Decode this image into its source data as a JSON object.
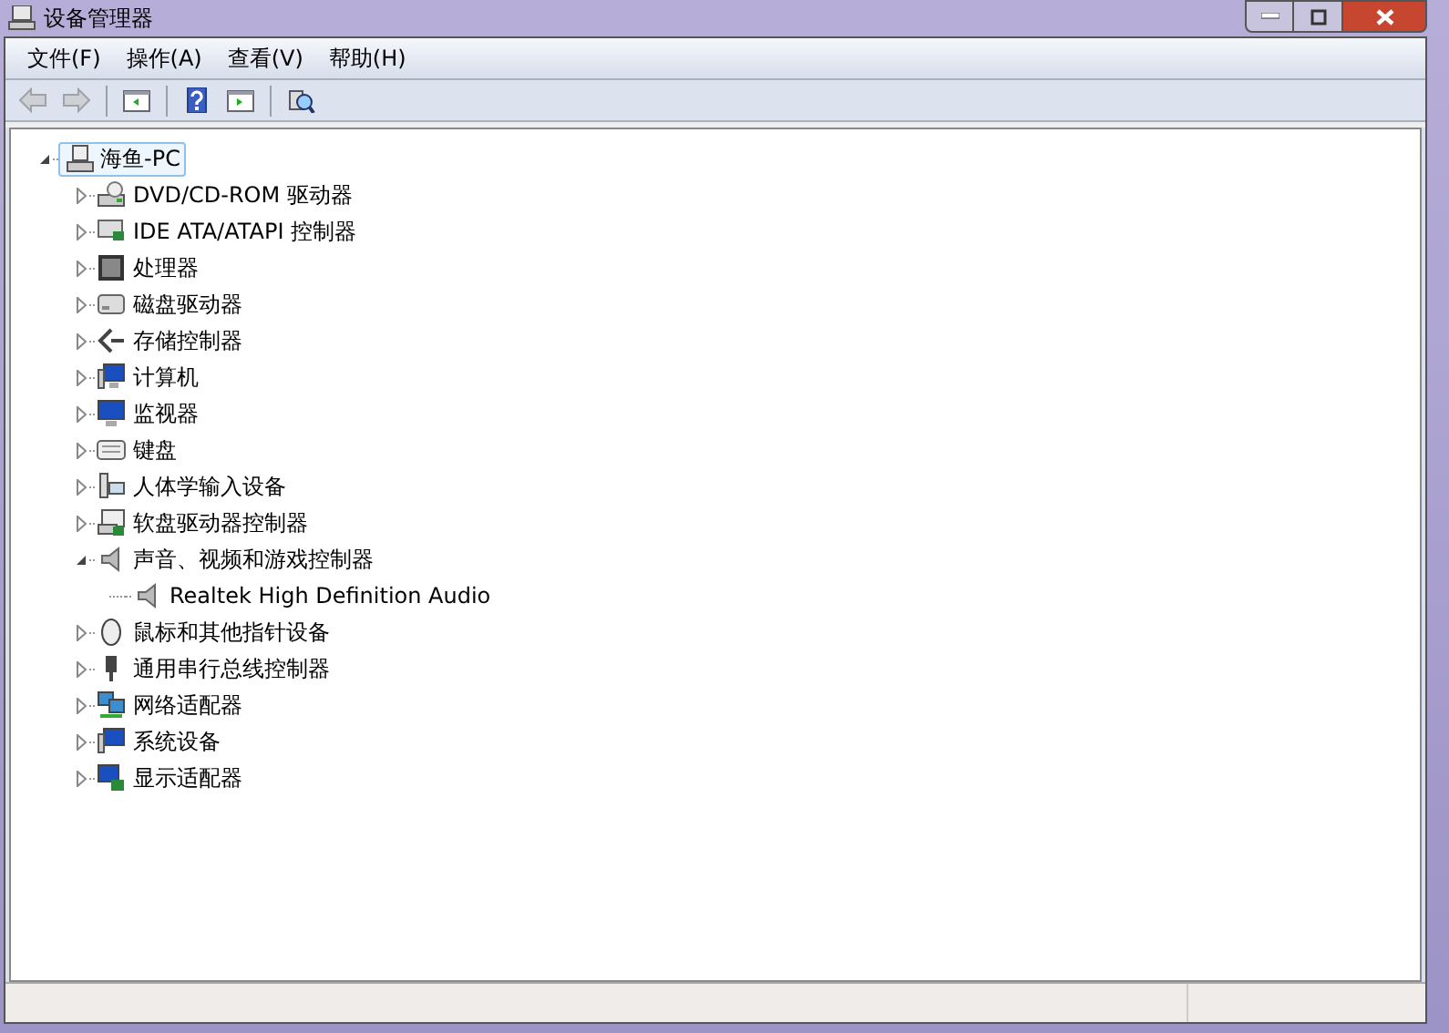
{
  "window": {
    "title": "设备管理器"
  },
  "menu": [
    {
      "label": "文件(F)"
    },
    {
      "label": "操作(A)"
    },
    {
      "label": "查看(V)"
    },
    {
      "label": "帮助(H)"
    }
  ],
  "toolbar": [
    {
      "kind": "back",
      "disabled": true
    },
    {
      "kind": "forward",
      "disabled": true
    },
    {
      "kind": "separator"
    },
    {
      "kind": "console",
      "disabled": false
    },
    {
      "kind": "separator"
    },
    {
      "kind": "help",
      "disabled": false
    },
    {
      "kind": "pane",
      "disabled": false
    },
    {
      "kind": "separator"
    },
    {
      "kind": "scan",
      "disabled": false
    }
  ],
  "tree": {
    "label": "海鱼-PC",
    "expanded": true,
    "selected": true,
    "children": [
      {
        "label": "DVD/CD-ROM 驱动器",
        "expanded": false
      },
      {
        "label": "IDE ATA/ATAPI 控制器",
        "expanded": false
      },
      {
        "label": "处理器",
        "expanded": false
      },
      {
        "label": "磁盘驱动器",
        "expanded": false
      },
      {
        "label": "存储控制器",
        "expanded": false
      },
      {
        "label": "计算机",
        "expanded": false
      },
      {
        "label": "监视器",
        "expanded": false
      },
      {
        "label": "键盘",
        "expanded": false
      },
      {
        "label": "人体学输入设备",
        "expanded": false
      },
      {
        "label": "软盘驱动器控制器",
        "expanded": false
      },
      {
        "label": "声音、视频和游戏控制器",
        "expanded": true,
        "children": [
          {
            "label": "Realtek High Definition Audio"
          }
        ]
      },
      {
        "label": "鼠标和其他指针设备",
        "expanded": false
      },
      {
        "label": "通用串行总线控制器",
        "expanded": false
      },
      {
        "label": "网络适配器",
        "expanded": false
      },
      {
        "label": "系统设备",
        "expanded": false
      },
      {
        "label": "显示适配器",
        "expanded": false
      }
    ]
  }
}
